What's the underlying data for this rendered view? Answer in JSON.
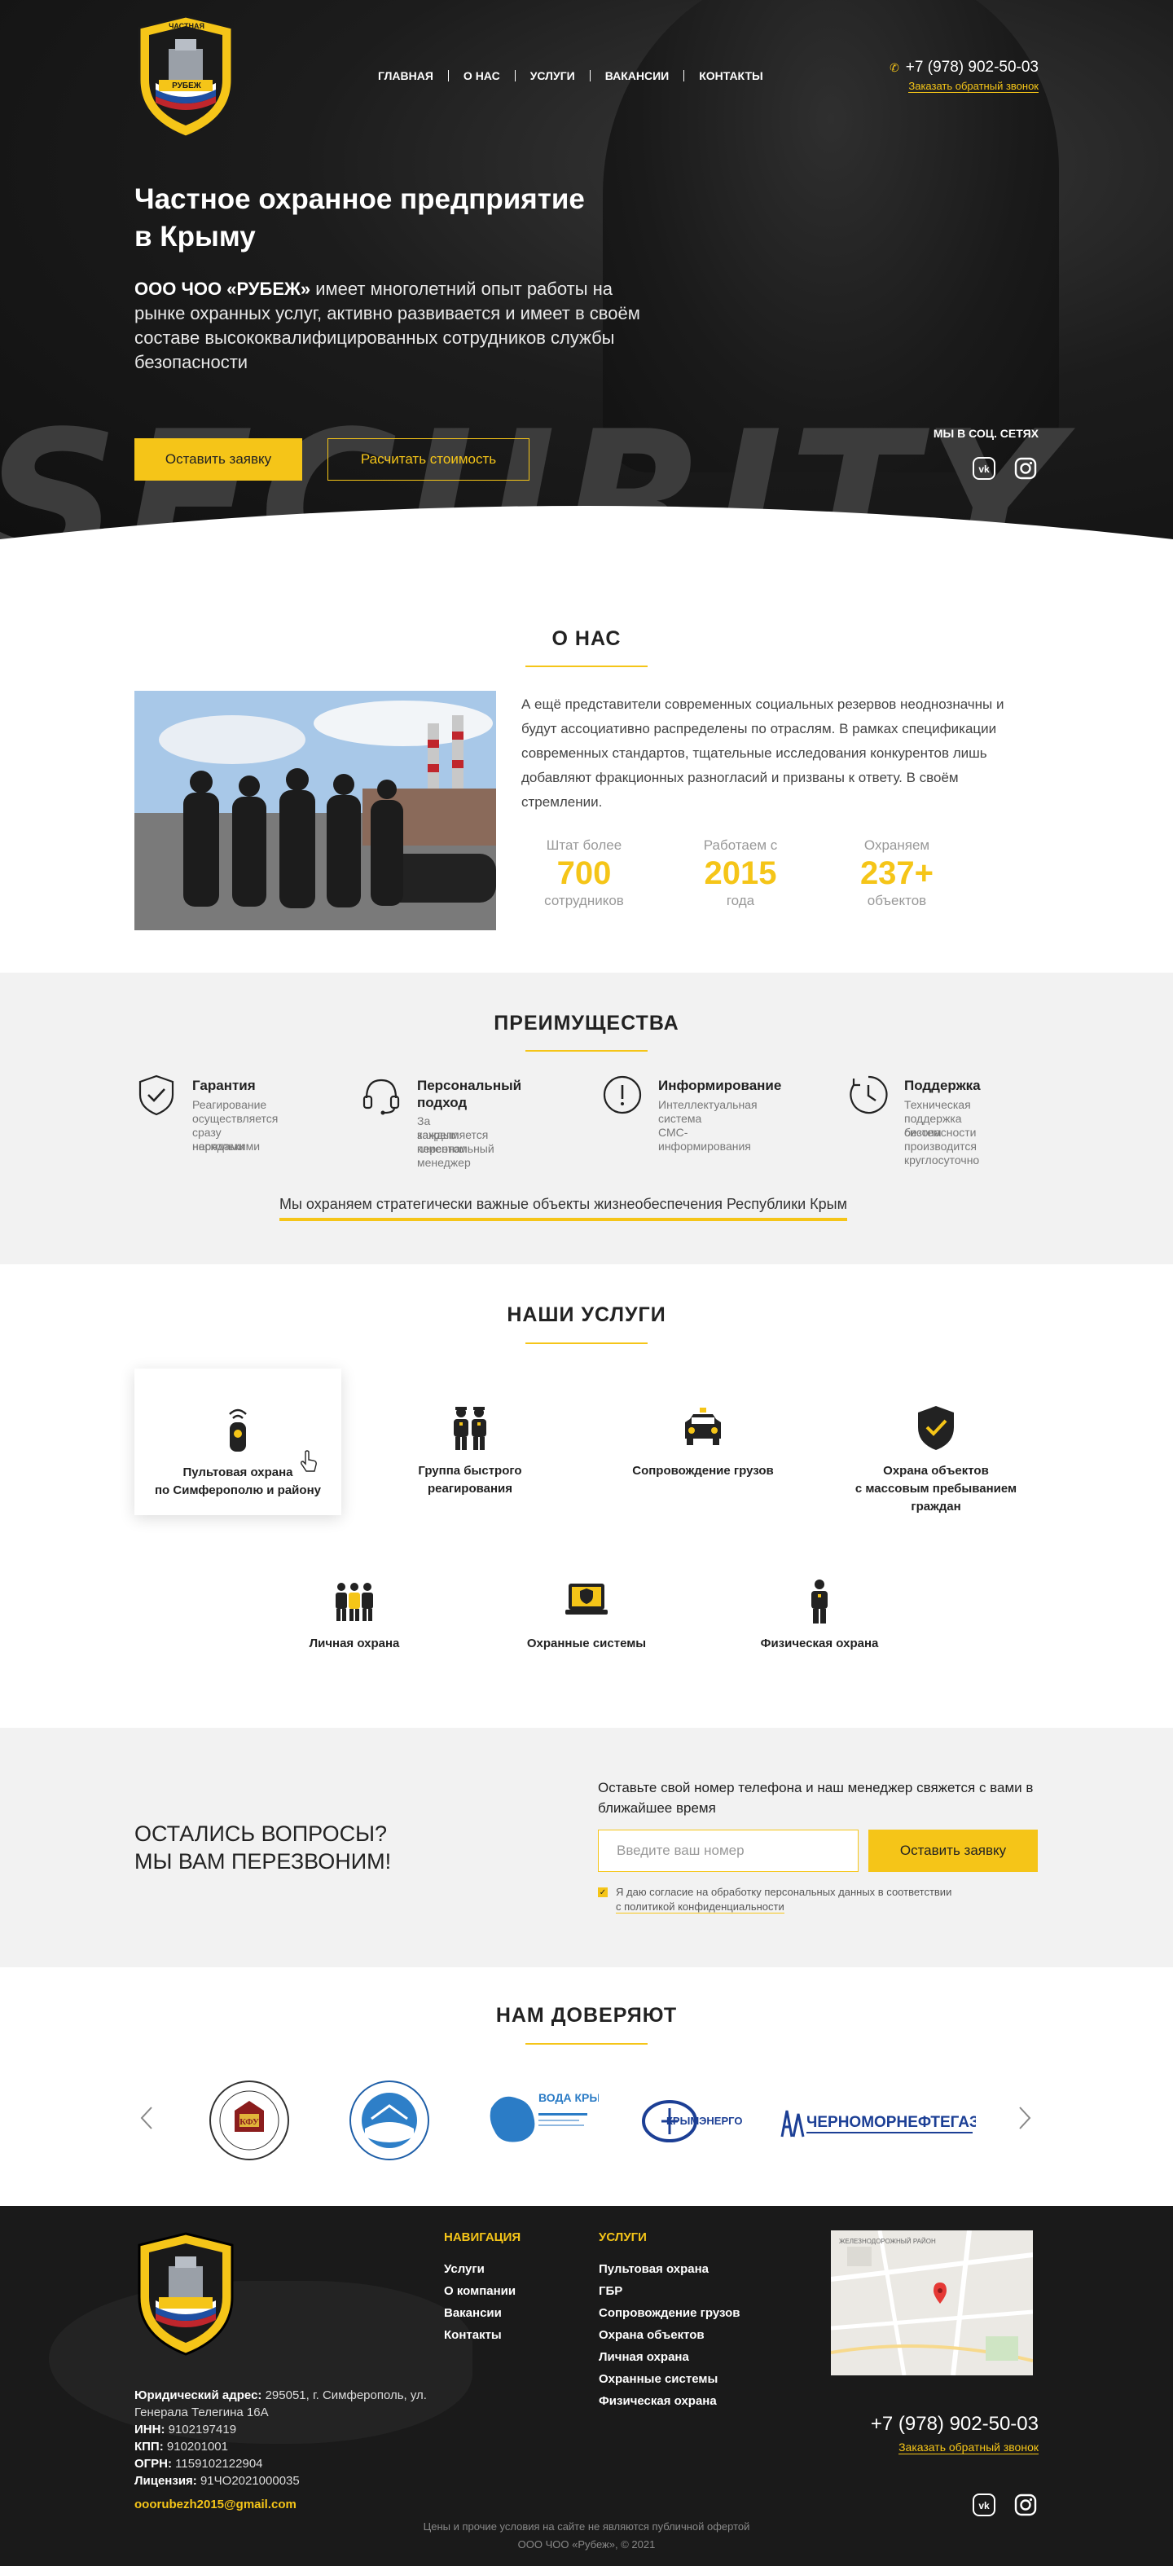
{
  "header": {
    "logo_text_top": "ЧАСТНАЯ",
    "logo_text_left": "ОХРАННАЯ",
    "logo_text_right": "ОРГАНИЗАЦИЯ",
    "logo_text_banner": "РУБЕЖ",
    "nav": [
      "ГЛАВНАЯ",
      "О НАС",
      "УСЛУГИ",
      "ВАКАНСИИ",
      "КОНТАКТЫ"
    ],
    "phone": "+7 (978) 902-50-03",
    "callback_link": "Заказать обратный звонок"
  },
  "hero": {
    "background_word": "SECURITY",
    "title_line1": "Частное охранное предприятие",
    "title_line2": "в Крыму",
    "lead_bold": "ООО ЧОО «РУБЕЖ»",
    "lead_rest": " имеет многолетний опыт работы на рынке охранных услуг, активно развивается и имеет в своём составе высококвалифицированных сотрудников службы безопасности",
    "btn_request": "Оставить заявку",
    "btn_price": "Расчитать стоимость",
    "social_title": "МЫ В СОЦ. СЕТЯХ",
    "social_icons": [
      "vk-icon",
      "instagram-icon"
    ]
  },
  "about": {
    "heading": "О НАС",
    "text": "А ещё представители современных социальных резервов неоднозначны и будут ассоциативно распределены по отраслям. В рамках спецификации современных стандартов, тщательные исследования конкурентов лишь добавляют фракционных разногласий и призваны к ответу. В своём стремлении.",
    "stats": [
      {
        "above": "Штат более",
        "value": "700",
        "below": "сотрудников"
      },
      {
        "above": "Работаем с",
        "value": "2015",
        "below": "года"
      },
      {
        "above": "Охраняем",
        "value": "237+",
        "below": "объектов"
      }
    ]
  },
  "advantages": {
    "heading": "ПРЕИМУЩЕСТВА",
    "items": [
      {
        "icon": "shield-check-icon",
        "title": "Гарантия",
        "desc": [
          "Реагирование",
          "осуществляется",
          "сразу несколькими",
          "нарядами"
        ]
      },
      {
        "icon": "headset-icon",
        "title": "Персональный\nподход",
        "desc": [
          "За каждым клиентом",
          "закрепляется",
          "персональный",
          "менеджер"
        ]
      },
      {
        "icon": "info-icon",
        "title": "Информирование",
        "desc": [
          "Интеллектуальная",
          "система",
          "СМС-информирования"
        ]
      },
      {
        "icon": "clock-icon",
        "title": "Поддержка",
        "desc": [
          "Техническая",
          "поддержка систем",
          "безопасности",
          "производится",
          "круглосуточно"
        ]
      }
    ],
    "note": "Мы охраняем стратегически важные объекты жизнеобеспечения Республики Крым"
  },
  "services": {
    "heading": "НАШИ УСЛУГИ",
    "items": [
      {
        "icon": "remote-alarm-icon",
        "label": "Пультовая охрана\nпо Симферополю и району"
      },
      {
        "icon": "rapid-response-icon",
        "label": "Группа быстрого\nреагирования"
      },
      {
        "icon": "escort-car-icon",
        "label": "Сопровождение грузов"
      },
      {
        "icon": "shield-check-icon",
        "label": "Охрана объектов\nс массовым пребыванием\nграждан"
      },
      {
        "icon": "bodyguard-icon",
        "label": "Личная охрана"
      },
      {
        "icon": "security-systems-icon",
        "label": "Охранные системы"
      },
      {
        "icon": "guard-icon",
        "label": "Физическая охрана"
      }
    ]
  },
  "callback": {
    "heading_line1": "ОСТАЛИСЬ ВОПРОСЫ?",
    "heading_line2": "МЫ ВАМ ПЕРЕЗВОНИМ!",
    "text": "Оставьте свой номер телефона и наш менеджер свяжется с вами в ближайшее время",
    "input_placeholder": "Введите ваш номер",
    "button": "Оставить заявку",
    "agree_line1": "Я даю согласие на обработку персональных данных в соответствии",
    "agree_line2": "с политикой конфиденциальности"
  },
  "trust": {
    "heading": "НАМ ДОВЕРЯЮТ",
    "logos": [
      {
        "name": "kfu-logo",
        "text": "КФУ"
      },
      {
        "name": "university-logo",
        "text": ""
      },
      {
        "name": "voda-kryma-logo",
        "text": "ВОДА КРЫМА"
      },
      {
        "name": "krymenergo-logo",
        "text": "КРЫМЭНЕРГО"
      },
      {
        "name": "chernomorneftegaz-logo",
        "text": "ЧЕРНОМОРНЕФТЕГАЗ"
      }
    ]
  },
  "footer": {
    "legal_address_label": "Юридический адрес:",
    "legal_address": " 295051, г. Симферополь, ул. Генерала Телегина 16А",
    "inn_label": "ИНН:",
    "inn": " 9102197419",
    "kpp_label": "КПП:",
    "kpp": " 910201001",
    "ogrn_label": "ОГРН:",
    "ogrn": " 1159102122904",
    "license_label": "Лицензия:",
    "license": " 91ЧО2021000035",
    "email": "ooorubezh2015@gmail.com",
    "nav_heading": "НАВИГАЦИЯ",
    "nav_items": [
      "Услуги",
      "О компании",
      "Вакансии",
      "Контакты"
    ],
    "services_heading": "УСЛУГИ",
    "services_items": [
      "Пультовая охрана",
      "ГБР",
      "Сопровождение грузов",
      "Охрана объектов",
      "Личная охрана",
      "Охранные системы",
      "Физическая охрана"
    ],
    "map_label": "ЖЕЛЕЗНОДОРОЖНЫЙ РАЙОН",
    "phone": "+7 (978) 902-50-03",
    "callback_link": "Заказать обратный звонок",
    "disclaimer": "Цены и прочие условия на сайте не являются публичной офертой",
    "copyright": "ООО ЧОО «Рубеж», © 2021"
  },
  "colors": {
    "accent": "#f5c518",
    "dark": "#1a1a1a",
    "light_bg": "#f2f2f2"
  }
}
